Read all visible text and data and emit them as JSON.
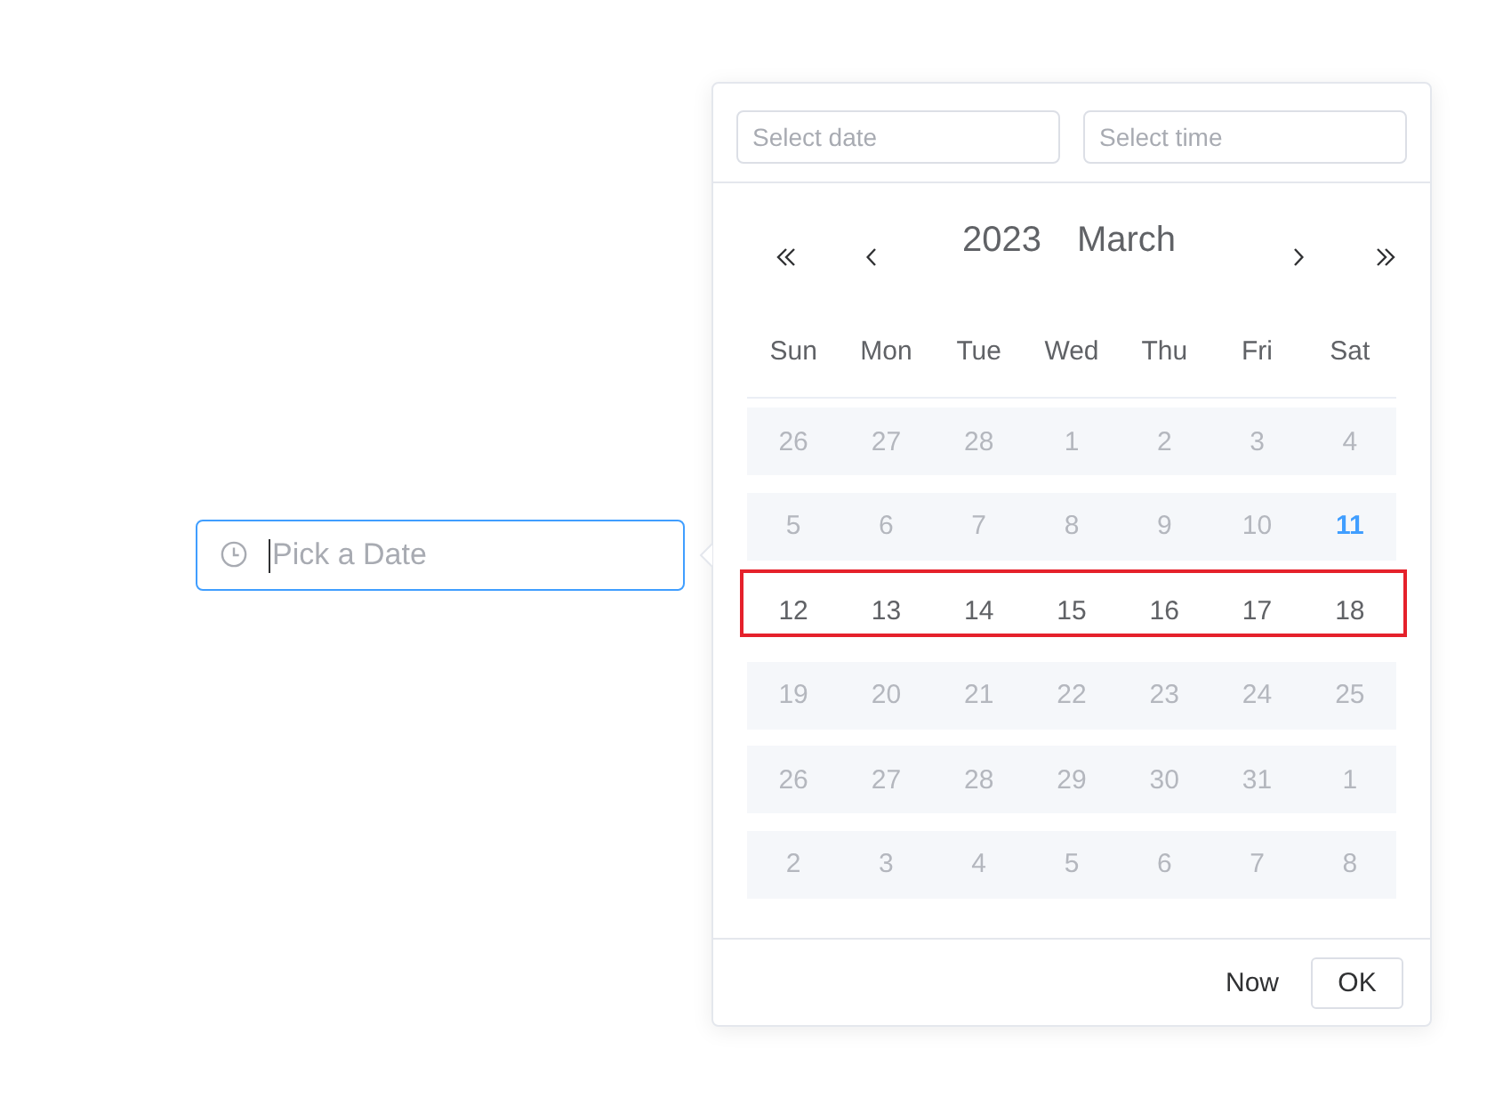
{
  "date_input": {
    "placeholder": "Pick a Date",
    "focused": true
  },
  "picker": {
    "date_field": {
      "placeholder": "Select date"
    },
    "time_field": {
      "placeholder": "Select time"
    },
    "year": "2023",
    "month": "March",
    "weekdays": [
      "Sun",
      "Mon",
      "Tue",
      "Wed",
      "Thu",
      "Fri",
      "Sat"
    ],
    "weeks": [
      {
        "highlighted": false,
        "days": [
          {
            "label": "26",
            "disabled": true,
            "today": false
          },
          {
            "label": "27",
            "disabled": true,
            "today": false
          },
          {
            "label": "28",
            "disabled": true,
            "today": false
          },
          {
            "label": "1",
            "disabled": true,
            "today": false
          },
          {
            "label": "2",
            "disabled": true,
            "today": false
          },
          {
            "label": "3",
            "disabled": true,
            "today": false
          },
          {
            "label": "4",
            "disabled": true,
            "today": false
          }
        ]
      },
      {
        "highlighted": false,
        "days": [
          {
            "label": "5",
            "disabled": true,
            "today": false
          },
          {
            "label": "6",
            "disabled": true,
            "today": false
          },
          {
            "label": "7",
            "disabled": true,
            "today": false
          },
          {
            "label": "8",
            "disabled": true,
            "today": false
          },
          {
            "label": "9",
            "disabled": true,
            "today": false
          },
          {
            "label": "10",
            "disabled": true,
            "today": false
          },
          {
            "label": "11",
            "disabled": true,
            "today": true
          }
        ]
      },
      {
        "highlighted": true,
        "days": [
          {
            "label": "12",
            "disabled": false,
            "today": false
          },
          {
            "label": "13",
            "disabled": false,
            "today": false
          },
          {
            "label": "14",
            "disabled": false,
            "today": false
          },
          {
            "label": "15",
            "disabled": false,
            "today": false
          },
          {
            "label": "16",
            "disabled": false,
            "today": false
          },
          {
            "label": "17",
            "disabled": false,
            "today": false
          },
          {
            "label": "18",
            "disabled": false,
            "today": false
          }
        ]
      },
      {
        "highlighted": false,
        "days": [
          {
            "label": "19",
            "disabled": true,
            "today": false
          },
          {
            "label": "20",
            "disabled": true,
            "today": false
          },
          {
            "label": "21",
            "disabled": true,
            "today": false
          },
          {
            "label": "22",
            "disabled": true,
            "today": false
          },
          {
            "label": "23",
            "disabled": true,
            "today": false
          },
          {
            "label": "24",
            "disabled": true,
            "today": false
          },
          {
            "label": "25",
            "disabled": true,
            "today": false
          }
        ]
      },
      {
        "highlighted": false,
        "days": [
          {
            "label": "26",
            "disabled": true,
            "today": false
          },
          {
            "label": "27",
            "disabled": true,
            "today": false
          },
          {
            "label": "28",
            "disabled": true,
            "today": false
          },
          {
            "label": "29",
            "disabled": true,
            "today": false
          },
          {
            "label": "30",
            "disabled": true,
            "today": false
          },
          {
            "label": "31",
            "disabled": true,
            "today": false
          },
          {
            "label": "1",
            "disabled": true,
            "today": false
          }
        ]
      },
      {
        "highlighted": false,
        "days": [
          {
            "label": "2",
            "disabled": true,
            "today": false
          },
          {
            "label": "3",
            "disabled": true,
            "today": false
          },
          {
            "label": "4",
            "disabled": true,
            "today": false
          },
          {
            "label": "5",
            "disabled": true,
            "today": false
          },
          {
            "label": "6",
            "disabled": true,
            "today": false
          },
          {
            "label": "7",
            "disabled": true,
            "today": false
          },
          {
            "label": "8",
            "disabled": true,
            "today": false
          }
        ]
      }
    ],
    "footer": {
      "now_button": "Now",
      "ok_button": "OK"
    }
  }
}
